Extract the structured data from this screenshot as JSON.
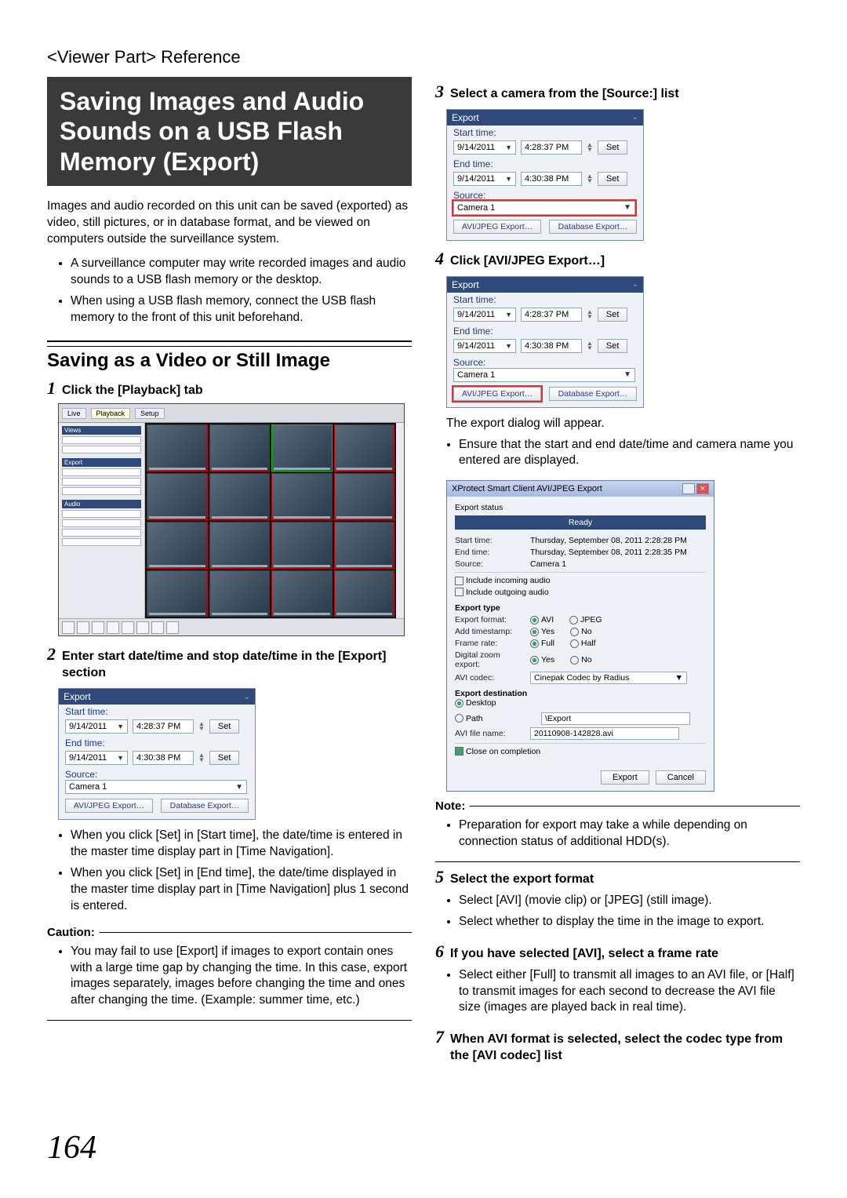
{
  "breadcrumb": "<Viewer Part> Reference",
  "title": "Saving Images and Audio Sounds on a USB Flash Memory (Export)",
  "intro": "Images and audio recorded on this unit can be saved (exported) as video, still pictures, or in database format, and be viewed on computers outside the surveillance system.",
  "intro_bullets": [
    "A surveillance computer may write recorded images and audio sounds to a USB flash memory or the desktop.",
    "When using a USB flash memory, connect the USB flash memory to the front of this unit beforehand."
  ],
  "section1_title": "Saving as a Video or Still Image",
  "steps": {
    "s1": "Click the [Playback] tab",
    "s2": "Enter start date/time and stop date/time in the [Export] section",
    "s3": "Select a camera from the [Source:] list",
    "s4": "Click [AVI/JPEG Export…]",
    "s5": "Select the export format",
    "s6": "If you have selected [AVI], select a frame rate",
    "s7": "When AVI format is selected, select the codec type from the [AVI codec] list"
  },
  "step2_notes": [
    "When you click [Set] in [Start time], the date/time is entered in the master time display part in [Time Navigation].",
    "When you click [Set] in [End time], the date/time displayed in the master time display part in [Time Navigation] plus 1 second is entered."
  ],
  "caution_label": "Caution:",
  "caution_items": [
    "You may fail to use [Export] if images to export contain ones with a large time gap by changing the time. In this case, export images separately, images before changing the time and ones after changing the time. (Example: summer time, etc.)"
  ],
  "step4_after": "The export dialog will appear.",
  "step4_bullets": [
    "Ensure that the start and end date/time and camera name you entered are displayed."
  ],
  "note_label": "Note:",
  "note_items": [
    "Preparation for export may take a while depending on connection status of additional HDD(s)."
  ],
  "step5_bullets": [
    "Select [AVI] (movie clip) or [JPEG] (still image).",
    "Select whether to display the time in the image to export."
  ],
  "step6_bullets": [
    "Select either [Full] to transmit all images to an AVI file, or [Half] to transmit images for each second to decrease the AVI file size (images are played back in real time)."
  ],
  "export_panel": {
    "title": "Export",
    "start_label": "Start time:",
    "start_date": "9/14/2011",
    "start_time": "4:28:37 PM",
    "end_label": "End time:",
    "end_date": "9/14/2011",
    "end_time": "4:30:38 PM",
    "set": "Set",
    "source_label": "Source:",
    "source_value": "Camera 1",
    "btn_avi": "AVI/JPEG Export…",
    "btn_db": "Database Export…"
  },
  "export_dialog": {
    "window_title": "XProtect Smart Client AVI/JPEG Export",
    "status_label": "Export status",
    "status_value": "Ready",
    "start_label": "Start time:",
    "start_value": "Thursday, September 08, 2011 2:28:28 PM",
    "end_label": "End time:",
    "end_value": "Thursday, September 08, 2011 2:28:35 PM",
    "source_label": "Source:",
    "source_value": "Camera 1",
    "audio_in": "Include incoming audio",
    "audio_out": "Include outgoing audio",
    "type_label": "Export type",
    "format_label": "Export format:",
    "avi": "AVI",
    "jpeg": "JPEG",
    "timestamp_label": "Add timestamp:",
    "yes": "Yes",
    "no": "No",
    "frame_label": "Frame rate:",
    "full": "Full",
    "half": "Half",
    "zoom_label": "Digital zoom export:",
    "codec_label": "AVI codec:",
    "codec_value": "Cinepak Codec by Radius",
    "dest_label": "Export destination",
    "desktop": "Desktop",
    "path": "Path",
    "path_value": "\\Export",
    "file_label": "AVI file name:",
    "file_value": "20110908-142828.avi",
    "close": "Close on completion",
    "export_btn": "Export",
    "cancel_btn": "Cancel"
  },
  "page_number": "164"
}
